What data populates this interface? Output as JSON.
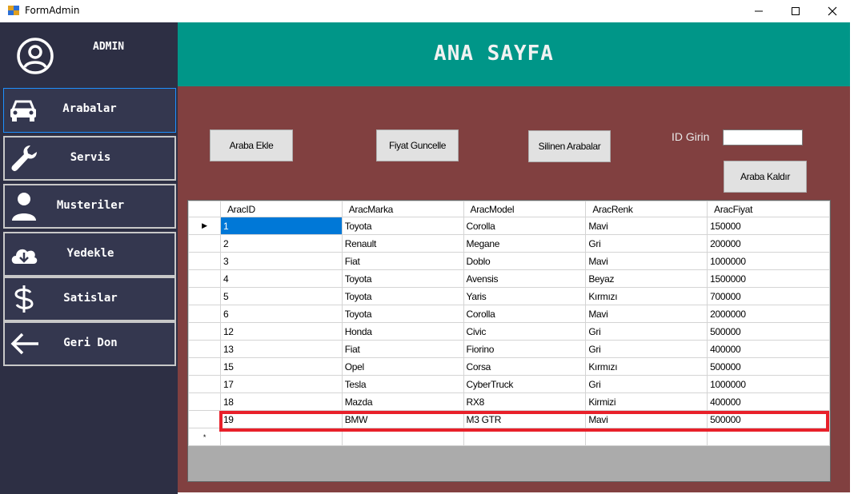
{
  "window": {
    "title": "FormAdmin"
  },
  "sidebar": {
    "user": "ADMIN",
    "items": [
      {
        "label": "Arabalar",
        "icon": "car-icon"
      },
      {
        "label": "Servis",
        "icon": "wrench-icon"
      },
      {
        "label": "Musteriler",
        "icon": "user-icon"
      },
      {
        "label": "Yedekle",
        "icon": "cloud-download-icon"
      },
      {
        "label": "Satislar",
        "icon": "dollar-icon"
      },
      {
        "label": "Geri Don",
        "icon": "arrow-left-icon"
      }
    ]
  },
  "header": {
    "title": "ANA SAYFA"
  },
  "toolbar": {
    "add_label": "Araba Ekle",
    "update_price_label": "Fiyat Guncelle",
    "deleted_label": "Silinen Arabalar",
    "id_label": "ID Girin",
    "id_value": "",
    "remove_label": "Araba Kaldır"
  },
  "grid": {
    "columns": [
      "AracID",
      "AracMarka",
      "AracModel",
      "AracRenk",
      "AracFiyat"
    ],
    "rows": [
      [
        "1",
        "Toyota",
        "Corolla",
        "Mavi",
        "150000"
      ],
      [
        "2",
        "Renault",
        "Megane",
        "Gri",
        "200000"
      ],
      [
        "3",
        "Fiat",
        "Doblo",
        "Mavi",
        "1000000"
      ],
      [
        "4",
        "Toyota",
        "Avensis",
        "Beyaz",
        "1500000"
      ],
      [
        "5",
        "Toyota",
        "Yaris",
        "Kırmızı",
        "700000"
      ],
      [
        "6",
        "Toyota",
        "Corolla",
        "Mavi",
        "2000000"
      ],
      [
        "12",
        "Honda",
        "Civic",
        "Gri",
        "500000"
      ],
      [
        "13",
        "Fiat",
        "Fiorino",
        "Gri",
        "400000"
      ],
      [
        "15",
        "Opel",
        "Corsa",
        "Kırmızı",
        "500000"
      ],
      [
        "17",
        "Tesla",
        "CyberTruck",
        "Gri",
        "1000000"
      ],
      [
        "18",
        "Mazda",
        "RX8",
        "Kirmizi",
        "400000"
      ],
      [
        "19",
        "BMW",
        "M3 GTR",
        "Mavi",
        "500000"
      ]
    ],
    "current_row_marker": "▶",
    "new_row_marker": "*",
    "selected_row": 0,
    "highlighted_row": 11
  },
  "colors": {
    "sidebar": "#2d2f44",
    "header": "#009688",
    "main": "#814040",
    "highlight": "#e8202a",
    "selection": "#0078d7"
  }
}
